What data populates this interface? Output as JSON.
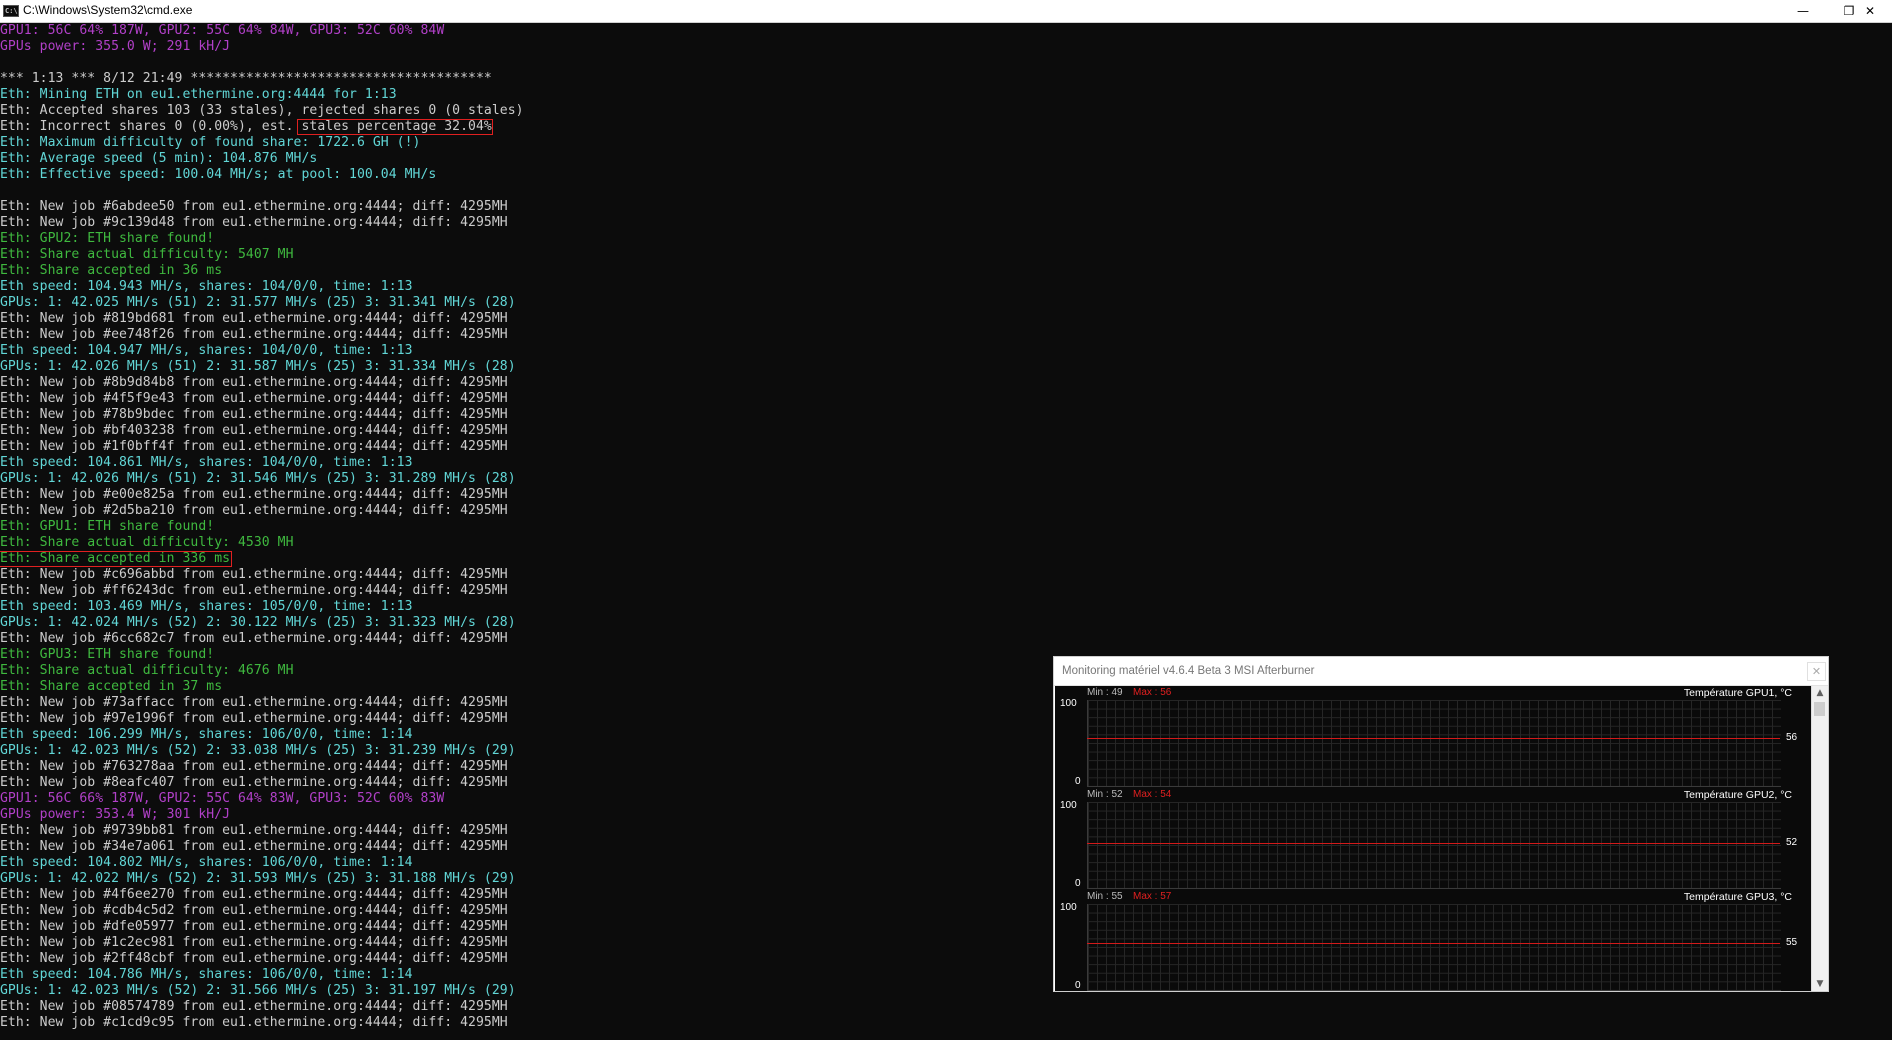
{
  "window": {
    "title": "C:\\Windows\\System32\\cmd.exe",
    "icon": "C:\\",
    "minimize_glyph": "—",
    "restore_glyph": "❐",
    "close_glyph": "✕"
  },
  "colors": {
    "white": "#cccccc",
    "cyan": "#61d6d6",
    "green": "#3fb93f",
    "magenta": "#b140c8",
    "highlight": "#e02020",
    "graph_line": "#d21a1a"
  },
  "console_lines": [
    {
      "text": "GPU1: 56C 64% 187W, GPU2: 55C 64% 84W, GPU3: 52C 60% 84W",
      "color": "magenta"
    },
    {
      "text": "GPUs power: 355.0 W; 291 kH/J",
      "color": "magenta"
    },
    {
      "text": "",
      "color": "white"
    },
    {
      "text": "*** 1:13 *** 8/12 21:49 **************************************",
      "color": "white"
    },
    {
      "text": "Eth: Mining ETH on eu1.ethermine.org:4444 for 1:13",
      "color": "cyan"
    },
    {
      "text": "Eth: Accepted shares 103 (33 stales), rejected shares 0 (0 stales)",
      "color": "white"
    },
    {
      "text": "Eth: Incorrect shares 0 (0.00%), est. stales percentage 32.04%",
      "color": "white"
    },
    {
      "text": "Eth: Maximum difficulty of found share: 1722.6 GH (!)",
      "color": "cyan"
    },
    {
      "text": "Eth: Average speed (5 min): 104.876 MH/s",
      "color": "cyan"
    },
    {
      "text": "Eth: Effective speed: 100.04 MH/s; at pool: 100.04 MH/s",
      "color": "cyan"
    },
    {
      "text": "",
      "color": "white"
    },
    {
      "text": "Eth: New job #6abdee50 from eu1.ethermine.org:4444; diff: 4295MH",
      "color": "white"
    },
    {
      "text": "Eth: New job #9c139d48 from eu1.ethermine.org:4444; diff: 4295MH",
      "color": "white"
    },
    {
      "text": "Eth: GPU2: ETH share found!",
      "color": "green"
    },
    {
      "text": "Eth: Share actual difficulty: 5407 MH",
      "color": "green"
    },
    {
      "text": "Eth: Share accepted in 36 ms",
      "color": "green"
    },
    {
      "text": "Eth speed: 104.943 MH/s, shares: 104/0/0, time: 1:13",
      "color": "cyan"
    },
    {
      "text": "GPUs: 1: 42.025 MH/s (51) 2: 31.577 MH/s (25) 3: 31.341 MH/s (28)",
      "color": "cyan"
    },
    {
      "text": "Eth: New job #819bd681 from eu1.ethermine.org:4444; diff: 4295MH",
      "color": "white"
    },
    {
      "text": "Eth: New job #ee748f26 from eu1.ethermine.org:4444; diff: 4295MH",
      "color": "white"
    },
    {
      "text": "Eth speed: 104.947 MH/s, shares: 104/0/0, time: 1:13",
      "color": "cyan"
    },
    {
      "text": "GPUs: 1: 42.026 MH/s (51) 2: 31.587 MH/s (25) 3: 31.334 MH/s (28)",
      "color": "cyan"
    },
    {
      "text": "Eth: New job #8b9d84b8 from eu1.ethermine.org:4444; diff: 4295MH",
      "color": "white"
    },
    {
      "text": "Eth: New job #4f5f9e43 from eu1.ethermine.org:4444; diff: 4295MH",
      "color": "white"
    },
    {
      "text": "Eth: New job #78b9bdec from eu1.ethermine.org:4444; diff: 4295MH",
      "color": "white"
    },
    {
      "text": "Eth: New job #bf403238 from eu1.ethermine.org:4444; diff: 4295MH",
      "color": "white"
    },
    {
      "text": "Eth: New job #1f0bff4f from eu1.ethermine.org:4444; diff: 4295MH",
      "color": "white"
    },
    {
      "text": "Eth speed: 104.861 MH/s, shares: 104/0/0, time: 1:13",
      "color": "cyan"
    },
    {
      "text": "GPUs: 1: 42.026 MH/s (51) 2: 31.546 MH/s (25) 3: 31.289 MH/s (28)",
      "color": "cyan"
    },
    {
      "text": "Eth: New job #e00e825a from eu1.ethermine.org:4444; diff: 4295MH",
      "color": "white"
    },
    {
      "text": "Eth: New job #2d5ba210 from eu1.ethermine.org:4444; diff: 4295MH",
      "color": "white"
    },
    {
      "text": "Eth: GPU1: ETH share found!",
      "color": "green"
    },
    {
      "text": "Eth: Share actual difficulty: 4530 MH",
      "color": "green"
    },
    {
      "text": "Eth: Share accepted in 336 ms",
      "color": "green"
    },
    {
      "text": "Eth: New job #c696abbd from eu1.ethermine.org:4444; diff: 4295MH",
      "color": "white"
    },
    {
      "text": "Eth: New job #ff6243dc from eu1.ethermine.org:4444; diff: 4295MH",
      "color": "white"
    },
    {
      "text": "Eth speed: 103.469 MH/s, shares: 105/0/0, time: 1:13",
      "color": "cyan"
    },
    {
      "text": "GPUs: 1: 42.024 MH/s (52) 2: 30.122 MH/s (25) 3: 31.323 MH/s (28)",
      "color": "cyan"
    },
    {
      "text": "Eth: New job #6cc682c7 from eu1.ethermine.org:4444; diff: 4295MH",
      "color": "white"
    },
    {
      "text": "Eth: GPU3: ETH share found!",
      "color": "green"
    },
    {
      "text": "Eth: Share actual difficulty: 4676 MH",
      "color": "green"
    },
    {
      "text": "Eth: Share accepted in 37 ms",
      "color": "green"
    },
    {
      "text": "Eth: New job #73affacc from eu1.ethermine.org:4444; diff: 4295MH",
      "color": "white"
    },
    {
      "text": "Eth: New job #97e1996f from eu1.ethermine.org:4444; diff: 4295MH",
      "color": "white"
    },
    {
      "text": "Eth speed: 106.299 MH/s, shares: 106/0/0, time: 1:14",
      "color": "cyan"
    },
    {
      "text": "GPUs: 1: 42.023 MH/s (52) 2: 33.038 MH/s (25) 3: 31.239 MH/s (29)",
      "color": "cyan"
    },
    {
      "text": "Eth: New job #763278aa from eu1.ethermine.org:4444; diff: 4295MH",
      "color": "white"
    },
    {
      "text": "Eth: New job #8eafc407 from eu1.ethermine.org:4444; diff: 4295MH",
      "color": "white"
    },
    {
      "text": "GPU1: 56C 66% 187W, GPU2: 55C 64% 83W, GPU3: 52C 60% 83W",
      "color": "magenta"
    },
    {
      "text": "GPUs power: 353.4 W; 301 kH/J",
      "color": "magenta"
    },
    {
      "text": "Eth: New job #9739bb81 from eu1.ethermine.org:4444; diff: 4295MH",
      "color": "white"
    },
    {
      "text": "Eth: New job #34e7a061 from eu1.ethermine.org:4444; diff: 4295MH",
      "color": "white"
    },
    {
      "text": "Eth speed: 104.802 MH/s, shares: 106/0/0, time: 1:14",
      "color": "cyan"
    },
    {
      "text": "GPUs: 1: 42.022 MH/s (52) 2: 31.593 MH/s (25) 3: 31.188 MH/s (29)",
      "color": "cyan"
    },
    {
      "text": "Eth: New job #4f6ee270 from eu1.ethermine.org:4444; diff: 4295MH",
      "color": "white"
    },
    {
      "text": "Eth: New job #cdb4c5d2 from eu1.ethermine.org:4444; diff: 4295MH",
      "color": "white"
    },
    {
      "text": "Eth: New job #dfe05977 from eu1.ethermine.org:4444; diff: 4295MH",
      "color": "white"
    },
    {
      "text": "Eth: New job #1c2ec981 from eu1.ethermine.org:4444; diff: 4295MH",
      "color": "white"
    },
    {
      "text": "Eth: New job #2ff48cbf from eu1.ethermine.org:4444; diff: 4295MH",
      "color": "white"
    },
    {
      "text": "Eth speed: 104.786 MH/s, shares: 106/0/0, time: 1:14",
      "color": "cyan"
    },
    {
      "text": "GPUs: 1: 42.023 MH/s (52) 2: 31.566 MH/s (25) 3: 31.197 MH/s (29)",
      "color": "cyan"
    },
    {
      "text": "Eth: New job #08574789 from eu1.ethermine.org:4444; diff: 4295MH",
      "color": "white"
    },
    {
      "text": "Eth: New job #c1cd9c95 from eu1.ethermine.org:4444; diff: 4295MH",
      "color": "white"
    }
  ],
  "highlights": [
    {
      "line": 6,
      "text": "stales percentage 32.04%"
    },
    {
      "line": 33,
      "text": "Eth: Share accepted in 336 ms"
    }
  ],
  "monitor": {
    "title": "Monitoring matériel  v4.6.4 Beta 3 MSI Afterburner",
    "close_glyph": "✕",
    "scroll_up_glyph": "▲",
    "scroll_down_glyph": "▼",
    "panels": [
      {
        "title": "Température GPU1, °C",
        "min": "Min : 49",
        "max": "Max : 56",
        "current": "56",
        "value": 56,
        "ymax": "100",
        "ymin": "0"
      },
      {
        "title": "Température GPU2, °C",
        "min": "Min : 52",
        "max": "Max : 54",
        "current": "52",
        "value": 52,
        "ymax": "100",
        "ymin": "0"
      },
      {
        "title": "Température GPU3, °C",
        "min": "Min : 55",
        "max": "Max : 57",
        "current": "55",
        "value": 55,
        "ymax": "100",
        "ymin": "0"
      }
    ]
  }
}
